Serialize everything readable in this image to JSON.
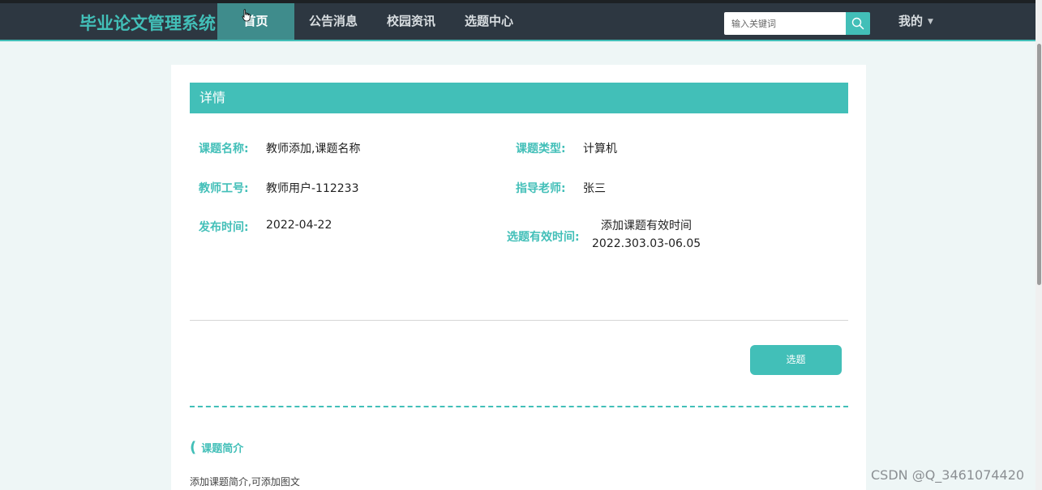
{
  "header": {
    "brand": "毕业论文管理系统",
    "nav": [
      {
        "label": "首页",
        "active": true
      },
      {
        "label": "公告消息",
        "active": false
      },
      {
        "label": "校园资讯",
        "active": false
      },
      {
        "label": "选题中心",
        "active": false
      }
    ],
    "search_placeholder": "输入关键词",
    "mine_label": "我的"
  },
  "detail": {
    "header": "详情",
    "fields": {
      "topic_name": {
        "label": "课题名称:",
        "value": "教师添加,课题名称"
      },
      "topic_type": {
        "label": "课题类型:",
        "value": "计算机"
      },
      "teacher_id": {
        "label": "教师工号:",
        "value": "教师用户-112233"
      },
      "advisor": {
        "label": "指导老师:",
        "value": "张三"
      },
      "publish_time": {
        "label": "发布时间:",
        "value": "2022-04-22"
      },
      "valid_time": {
        "label": "选题有效时间:",
        "value_line1": "添加课题有效时间",
        "value_line2": "2022.303.03-06.05"
      }
    },
    "select_button": "选题",
    "intro_title": "课题简介",
    "intro_text": "添加课题简介,可添加图文"
  },
  "watermark": "CSDN @Q_3461074420",
  "colors": {
    "accent": "#42bfb8",
    "navbar": "#2d3741",
    "background": "#eef6f6"
  }
}
